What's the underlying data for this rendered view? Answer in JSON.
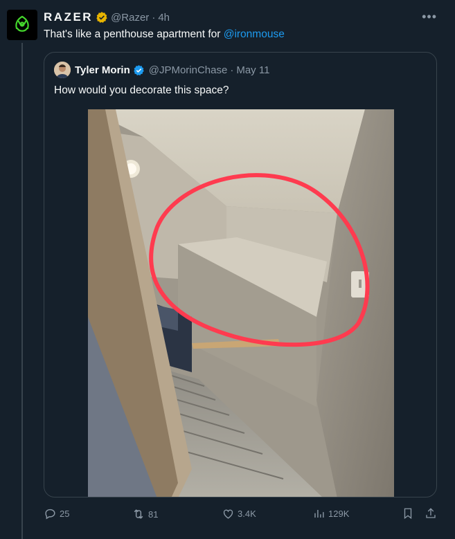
{
  "tweet": {
    "author": "RAZER",
    "handle": "@Razer",
    "time": "4h",
    "text": "That's like a penthouse apartment for ",
    "mention": "@ironmouse"
  },
  "quoted": {
    "name": "Tyler Morin",
    "handle": "@JPMorinChase",
    "date": "May 11",
    "text": "How would you decorate this space?"
  },
  "actions": {
    "replies": "25",
    "reposts": "81",
    "likes": "3.4K",
    "views": "129K"
  },
  "colors": {
    "background": "#15202b",
    "accent": "#1d9bf0",
    "muted": "#8b98a5",
    "razer_verified": "#e8b400",
    "circle": "#ff3b4f"
  }
}
